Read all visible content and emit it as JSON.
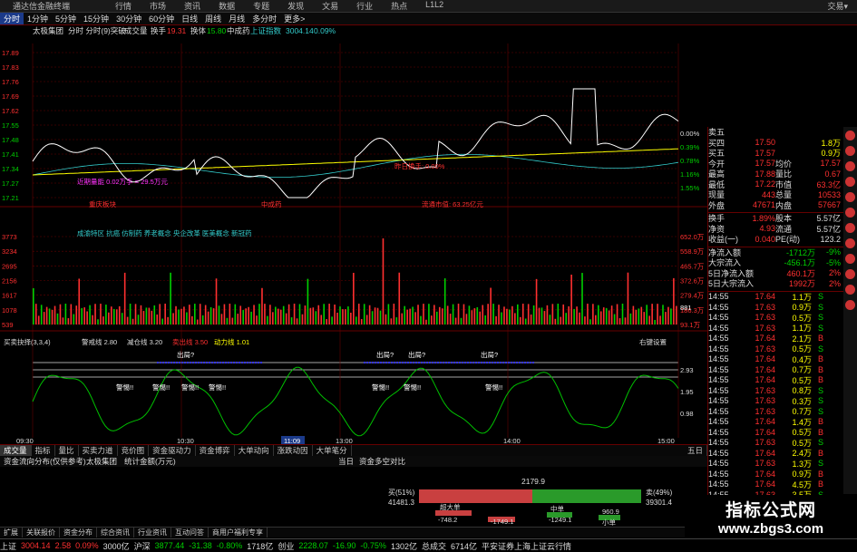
{
  "app": {
    "title": "通达信金融终端",
    "menus": [
      "行情",
      "市场",
      "资讯",
      "数据",
      "专题",
      "发现",
      "文易",
      "行业",
      "热点",
      "L1L2"
    ],
    "right_title": "交易▾"
  },
  "toolbar": {
    "items": [
      "分时",
      "1分钟",
      "5分钟",
      "15分钟",
      "30分钟",
      "60分钟",
      "日线",
      "周线",
      "月线",
      "多分时",
      "更多>"
    ]
  },
  "chart_header": {
    "name": "太极集团",
    "mode": "分时 分时(9)突破",
    "indicator": "成交量",
    "field_a": "换手",
    "field_a_val": "19.31",
    "field_b": "换体",
    "field_b_val": "15.80",
    "stock": "中成药",
    "index_label": "上证指数",
    "index_val": "3004.14",
    "index_pct": "0.09%"
  },
  "price_axis_left": [
    "17.89",
    "17.83",
    "17.76",
    "17.69",
    "17.62",
    "17.55",
    "17.48",
    "17.41",
    "17.34",
    "17.27",
    "17.21"
  ],
  "price_axis_right": [
    "0.00%",
    "0.39%",
    "0.78%",
    "1.16%",
    "1.55%"
  ],
  "vol_axis_left": [
    "3773",
    "3234",
    "2695",
    "2156",
    "1617",
    "1078",
    "539"
  ],
  "vol_axis_right": [
    "652.0万",
    "558.9万",
    "465.7万",
    "372.6万",
    "279.4万",
    "186.3万",
    "93.1万"
  ],
  "osc_axis_right": [
    "2.93",
    "1.95",
    "0.98"
  ],
  "time_axis": [
    "09:30",
    "10:30",
    "11:09",
    "13:00",
    "14:00",
    "15:00"
  ],
  "annotations": {
    "avg_vol": "近期量能 0.02万手 = 29.5万元",
    "sector": "重庆板块",
    "industry": "中成药",
    "float_mv": "流通市值: 63.25亿元",
    "prev_turnover": "昨日换手: 0.00%",
    "concepts": "成渝特区 抗癌 仿制药 养老概念 央企改革 医美概念 新冠药",
    "osc_title": "买卖抉择(3,3,4)",
    "osc_a": "警戒线 2.80",
    "osc_b": "减仓线 3.20",
    "osc_c": "卖出线 3.50",
    "osc_d": "动力线 1.01",
    "osc_settings": "右键设置",
    "sell_q": "出局?",
    "warn": "警惕!!",
    "warn2": "警惕!!",
    "warn3": "警惕!!",
    "warn4": "警惕!!",
    "warn5": "警惕!!",
    "warn6": "警惕!!",
    "warn7": "警惕!!",
    "vol_mark": "881"
  },
  "side_quote": [
    {
      "l": "卖五",
      "v": "",
      "v2": "",
      "c": "red"
    },
    {
      "l": "买四",
      "v": "17.50",
      "v2": "1.8万",
      "c": "red"
    },
    {
      "l": "买五",
      "v": "17.57",
      "v2": "0.9万",
      "c": "red"
    },
    {
      "l": "今开",
      "v": "17.57",
      "l2": "均价",
      "v3": "17.57"
    },
    {
      "l": "最高",
      "v": "17.88",
      "l2": "量比",
      "v3": "0.67"
    },
    {
      "l": "最低",
      "v": "17.22",
      "l2": "市值",
      "v3": "63.3亿"
    },
    {
      "l": "现量",
      "v": "443",
      "l2": "总量",
      "v3": "10533"
    },
    {
      "l": "外盘",
      "v": "47671",
      "l2": "内盘",
      "v3": "57667"
    }
  ],
  "side_stats": [
    {
      "l": "换手",
      "v": "1.89%",
      "l2": "股本",
      "v3": "5.57亿"
    },
    {
      "l": "净资",
      "v": "4.93",
      "l2": "流通",
      "v3": "5.57亿"
    },
    {
      "l": "收益(一)",
      "v": "0.040",
      "l2": "PE(动)",
      "v3": "123.2"
    }
  ],
  "side_flow": [
    {
      "l": "净流入额",
      "v": "-1712万",
      "p": "-9%",
      "c": "grn"
    },
    {
      "l": "大宗流入",
      "v": "-456.1万",
      "p": "-5%",
      "c": "grn"
    },
    {
      "l": "5日净流入额",
      "v": "460.1万",
      "p": "2%",
      "c": "red"
    },
    {
      "l": "5日大宗流入",
      "v": "1992万",
      "p": "2%",
      "c": "red"
    }
  ],
  "ticks": [
    {
      "t": "14:55",
      "p": "17.64",
      "v": "1.1万",
      "s": "S"
    },
    {
      "t": "14:55",
      "p": "17.63",
      "v": "0.9万",
      "s": "S"
    },
    {
      "t": "14:55",
      "p": "17.63",
      "v": "0.5万",
      "s": "S"
    },
    {
      "t": "14:55",
      "p": "17.63",
      "v": "1.1万",
      "s": "S"
    },
    {
      "t": "14:55",
      "p": "17.64",
      "v": "2.1万",
      "s": "B"
    },
    {
      "t": "14:55",
      "p": "17.63",
      "v": "0.5万",
      "s": "S"
    },
    {
      "t": "14:55",
      "p": "17.64",
      "v": "0.4万",
      "s": "B"
    },
    {
      "t": "14:55",
      "p": "17.64",
      "v": "0.7万",
      "s": "B"
    },
    {
      "t": "14:55",
      "p": "17.64",
      "v": "0.5万",
      "s": "B"
    },
    {
      "t": "14:55",
      "p": "17.63",
      "v": "0.8万",
      "s": "S"
    },
    {
      "t": "14:55",
      "p": "17.63",
      "v": "0.3万",
      "s": "S"
    },
    {
      "t": "14:55",
      "p": "17.63",
      "v": "0.7万",
      "s": "S"
    },
    {
      "t": "14:55",
      "p": "17.64",
      "v": "1.4万",
      "s": "B"
    },
    {
      "t": "14:55",
      "p": "17.64",
      "v": "0.5万",
      "s": "B"
    },
    {
      "t": "14:55",
      "p": "17.63",
      "v": "0.5万",
      "s": "S"
    },
    {
      "t": "14:55",
      "p": "17.64",
      "v": "2.4万",
      "s": "B"
    },
    {
      "t": "14:55",
      "p": "17.63",
      "v": "1.3万",
      "s": "S"
    },
    {
      "t": "14:55",
      "p": "17.64",
      "v": "0.9万",
      "s": "B"
    },
    {
      "t": "14:55",
      "p": "17.64",
      "v": "4.5万",
      "s": "B"
    },
    {
      "t": "14:55",
      "p": "17.63",
      "v": "3.5万",
      "s": "S"
    }
  ],
  "tabs_bottom": [
    "成交量",
    "指标",
    "量比",
    "买卖力道",
    "竞价图",
    "资金驱动力",
    "资金博弈",
    "大单动向",
    "涨跌动因",
    "大单笔分"
  ],
  "tabs_bottom_right": "五日",
  "lower": {
    "left_title": "资金流向分布(仅供参考)",
    "left_stock": "太极集团",
    "left_sub": "统计金额(万元)",
    "mid": "当日",
    "mid_title": "资金多空对比",
    "total": "2179.9",
    "buy_label": "买(51%)",
    "buy_val": "41481.3",
    "sell_label": "卖(49%)",
    "sell_val": "39301.4",
    "b1_label": "超大单",
    "b1_val": "-748.2",
    "b2_label": "大单",
    "b2_val": "-1749.1",
    "b3_label": "中单",
    "b3_val": "-1249.1",
    "b4_label": "小单",
    "b4_val": "960.9"
  },
  "tabs_lower": [
    "扩展",
    "关联报价",
    "资金分布",
    "综合资讯",
    "行业资讯",
    "互动问答",
    "商用户福利专享"
  ],
  "status": [
    {
      "t": "上证",
      "c": "wht"
    },
    {
      "t": "3004.14",
      "c": "red"
    },
    {
      "t": "2.58",
      "c": "red"
    },
    {
      "t": "0.09%",
      "c": "red"
    },
    {
      "t": "3000亿",
      "c": "wht"
    },
    {
      "t": "沪深",
      "c": "wht"
    },
    {
      "t": "3877.44",
      "c": "grn"
    },
    {
      "t": "-31.38",
      "c": "grn"
    },
    {
      "t": "-0.80%",
      "c": "grn"
    },
    {
      "t": "1718亿",
      "c": "wht"
    },
    {
      "t": "创业",
      "c": "wht"
    },
    {
      "t": "2228.07",
      "c": "grn"
    },
    {
      "t": "-16.90",
      "c": "grn"
    },
    {
      "t": "-0.75%",
      "c": "grn"
    },
    {
      "t": "1302亿",
      "c": "wht"
    },
    {
      "t": "总成交",
      "c": "wht"
    },
    {
      "t": "6714亿",
      "c": "wht"
    },
    {
      "t": "平安证券上海上证云行情",
      "c": "wht"
    }
  ],
  "watermark": {
    "a": "指标公式网",
    "b": "www.zbgs3.com"
  },
  "colors": {
    "up": "#ff3030",
    "down": "#00d000",
    "price": "#ffffff",
    "avg": "#ffff00",
    "grid": "#600000"
  }
}
